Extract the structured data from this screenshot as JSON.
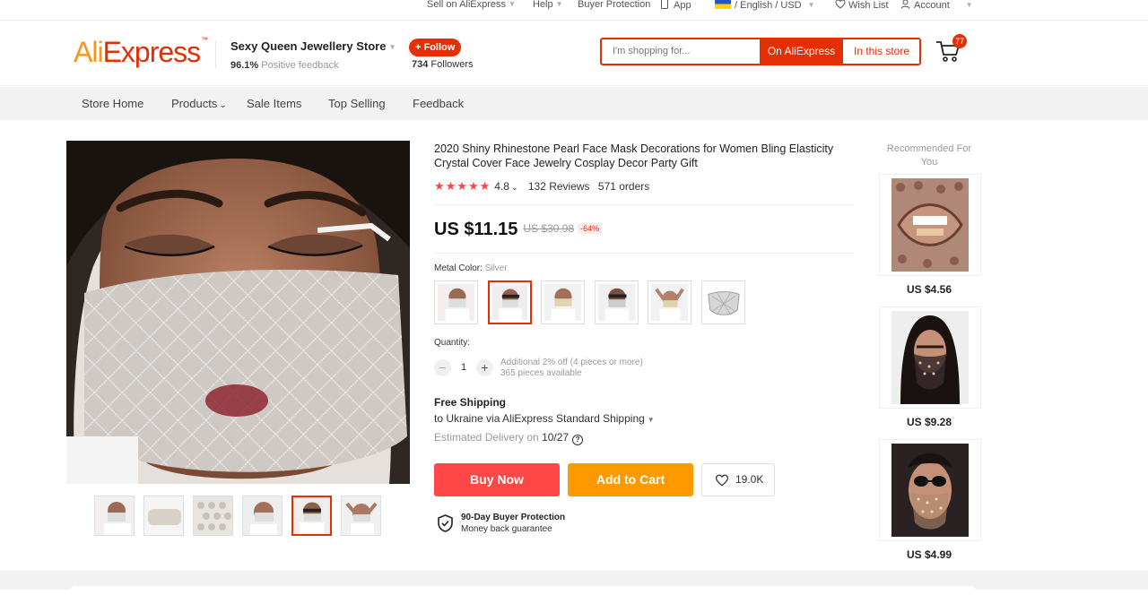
{
  "topbar": {
    "sell": "Sell on AliExpress",
    "help": "Help",
    "protection": "Buyer Protection",
    "app": "App",
    "lang": "/ English /",
    "currency": "USD",
    "wishlist": "Wish List",
    "account": "Account"
  },
  "header": {
    "logo_ali": "Ali",
    "logo_express": "Express",
    "logo_tm": "™",
    "store_name": "Sexy Queen Jewellery Store",
    "feedback_pct": "96.1%",
    "feedback_label": "Positive feedback",
    "follow": "+ Follow",
    "followers_count": "734",
    "followers_label": "Followers",
    "search_placeholder": "I'm shopping for...",
    "search_ae": "On AliExpress",
    "search_store": "In this store",
    "cart_count": "77"
  },
  "nav": {
    "tabs": [
      "Store Home",
      "Products",
      "Sale Items",
      "Top Selling",
      "Feedback"
    ]
  },
  "product": {
    "title": "2020 Shiny Rhinestone Pearl Face Mask Decorations for Women Bling Elasticity Crystal Cover Face Jewelry Cosplay Decor Party Gift",
    "stars": "★★★★★",
    "rating": "4.8",
    "reviews": "132 Reviews",
    "orders": "571 orders",
    "price": "US $11.15",
    "original_price": "US $30.98",
    "discount": "-64%",
    "color_label": "Metal Color:",
    "color_value": "Silver",
    "quantity_label": "Quantity:",
    "quantity": "1",
    "qty_minus": "−",
    "qty_plus": "+",
    "qty_note": "Additional 2% off (4 pieces or more)",
    "available": "365 pieces available",
    "ship_title": "Free Shipping",
    "ship_dest": "to Ukraine via AliExpress Standard Shipping",
    "eta_label": "Estimated Delivery on",
    "eta_date": "10/27",
    "buy_now": "Buy Now",
    "add_to_cart": "Add to Cart",
    "wish_count": "19.0K",
    "protection_title": "90-Day Buyer Protection",
    "protection_sub": "Money back guarantee"
  },
  "recommended": {
    "title": "Recommended For You",
    "items": [
      {
        "price": "US $4.56"
      },
      {
        "price": "US $9.28"
      },
      {
        "price": "US $4.99"
      }
    ]
  },
  "colors": {
    "brand": "#e62e04",
    "buy": "#ff4747",
    "cart": "#ff9900"
  }
}
